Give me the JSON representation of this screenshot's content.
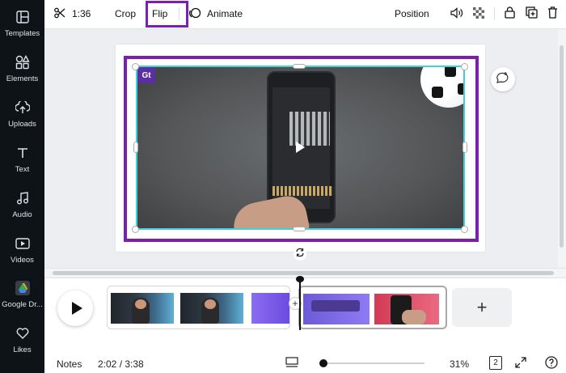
{
  "sidebar": {
    "items": [
      {
        "label": "Templates",
        "icon": "templates-icon"
      },
      {
        "label": "Elements",
        "icon": "elements-icon"
      },
      {
        "label": "Uploads",
        "icon": "uploads-icon"
      },
      {
        "label": "Text",
        "icon": "text-icon"
      },
      {
        "label": "Audio",
        "icon": "audio-icon"
      },
      {
        "label": "Videos",
        "icon": "videos-icon"
      },
      {
        "label": "Google Dr...",
        "icon": "google-drive-icon"
      },
      {
        "label": "Likes",
        "icon": "heart-icon"
      }
    ]
  },
  "toolbar": {
    "duration": "1:36",
    "crop_label": "Crop",
    "flip_label": "Flip",
    "animate_label": "Animate",
    "position_label": "Position"
  },
  "canvas": {
    "logo_text": "Gt"
  },
  "footer": {
    "notes_label": "Notes",
    "time": "2:02 / 3:38",
    "zoom": "31%",
    "page_count": "2"
  },
  "colors": {
    "selection": "#7a1fb0",
    "video_outline": "#3ed1d8",
    "sidebar_bg": "#0e1318"
  }
}
